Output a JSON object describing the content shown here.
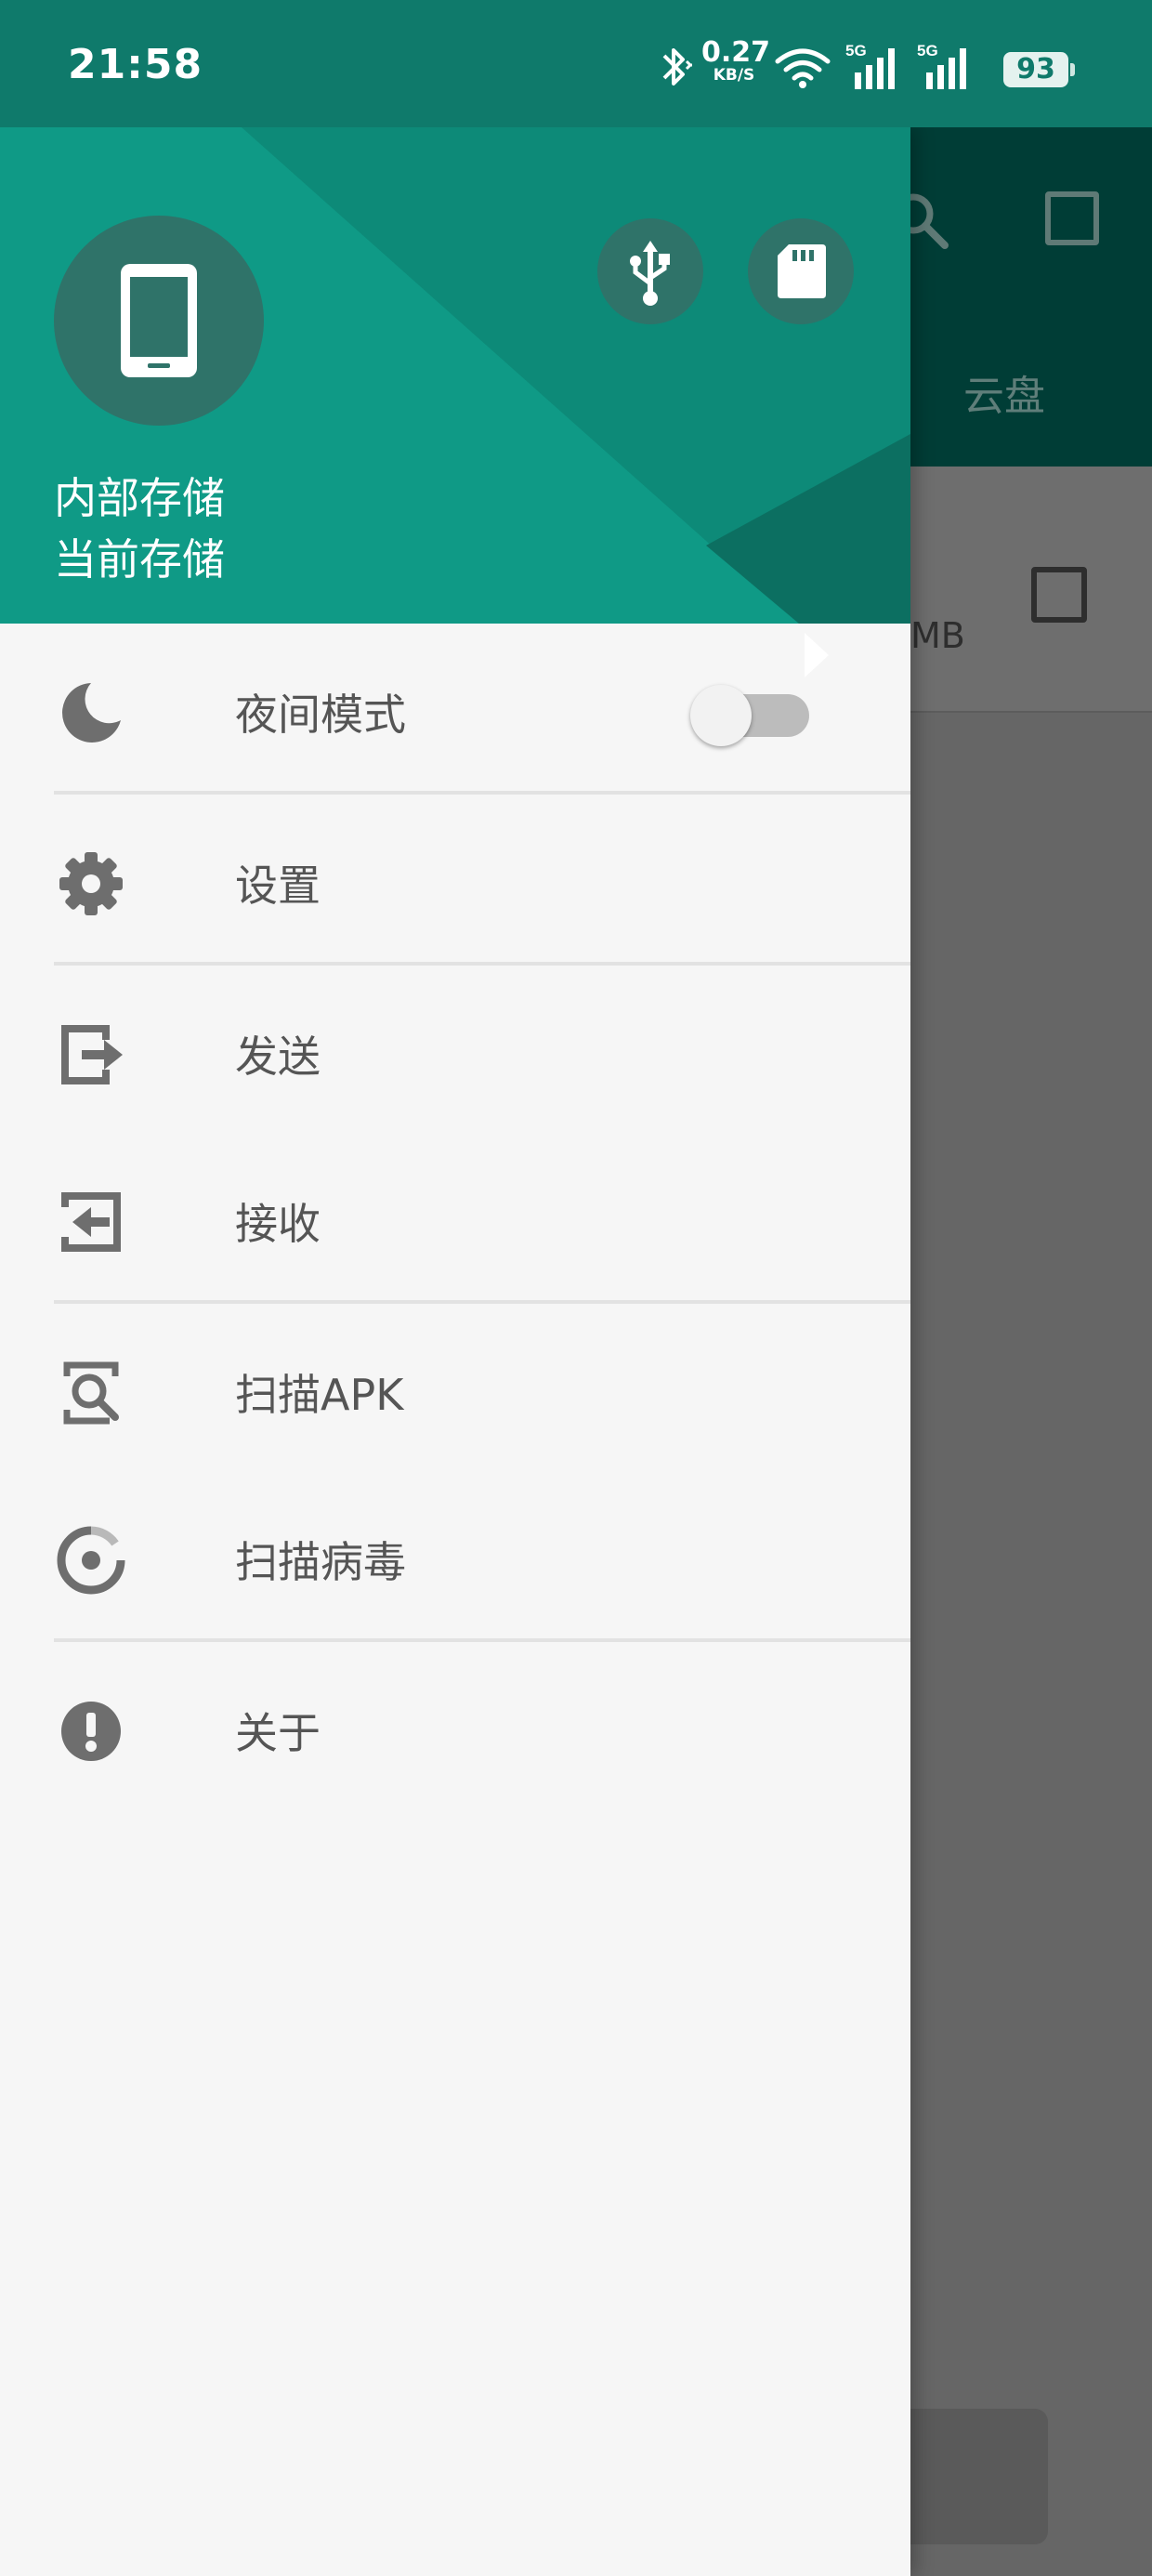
{
  "status_bar": {
    "time": "21:58",
    "net_speed_value": "0.27",
    "net_speed_unit": "KB/S",
    "battery": "93",
    "icons": [
      "bluetooth-icon",
      "wifi-icon",
      "signal-5g-icon",
      "signal-5g-icon",
      "battery-icon"
    ]
  },
  "background_app": {
    "tab_label": "云盘",
    "row_size": "MB",
    "toolbar_icons": [
      "search-icon",
      "select-all-checkbox"
    ]
  },
  "drawer": {
    "header": {
      "storage_name": "内部存储",
      "storage_status": "当前存储",
      "icons": [
        "phone-icon",
        "usb-icon",
        "sd-card-icon",
        "chevron-right-icon"
      ]
    },
    "menu": {
      "night_mode": {
        "label": "夜间模式",
        "icon": "moon-icon",
        "toggle_on": false
      },
      "settings": {
        "label": "设置",
        "icon": "gear-icon"
      },
      "send": {
        "label": "发送",
        "icon": "send-icon"
      },
      "receive": {
        "label": "接收",
        "icon": "receive-icon"
      },
      "scan_apk": {
        "label": "扫描APK",
        "icon": "scan-apk-icon"
      },
      "scan_virus": {
        "label": "扫描病毒",
        "icon": "scan-virus-icon"
      },
      "about": {
        "label": "关于",
        "icon": "info-icon"
      }
    }
  },
  "colors": {
    "status_bar": "#0f7a6b",
    "drawer_header": "#0f8f7d",
    "drawer_background": "#f6f6f6",
    "icon_gray": "#6e6e6e",
    "text_gray": "#555555",
    "scrim": "#666666"
  }
}
